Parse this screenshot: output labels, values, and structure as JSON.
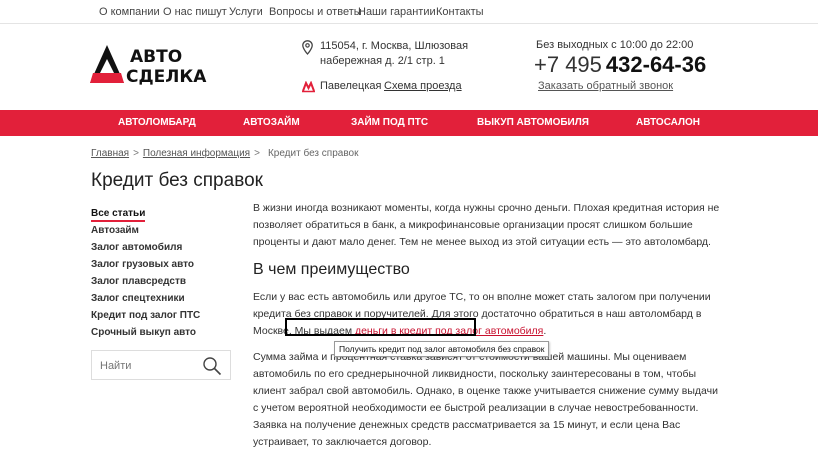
{
  "top_menu": {
    "about": "О компании",
    "press": "О нас пишут",
    "services": "Услуги",
    "faq": "Вопросы и ответы",
    "guarantees": "Наши гарантии",
    "contacts": "Контакты"
  },
  "logo": {
    "line1": "АВТО",
    "line2": "СДЕЛКА"
  },
  "header": {
    "address_line1": "115054, г. Москва, Шлюзовая",
    "address_line2": "набережная д. 2/1 стр. 1",
    "metro": "Павелецкая",
    "route_link": "Схема проезда",
    "hours": "Без выходных с 10:00 до 22:00",
    "phone_code": "+7 495",
    "phone_number": "432-64-36",
    "callback": "Заказать обратный звонок"
  },
  "nav": {
    "item1": "АВТОЛОМБАРД",
    "item2": "АВТОЗАЙМ",
    "item3": "ЗАЙМ ПОД ПТС",
    "item4": "ВЫКУП АВТОМОБИЛЯ",
    "item5": "АВТОСАЛОН"
  },
  "breadcrumb": {
    "home": "Главная",
    "section": "Полезная информация",
    "current": "Кредит без справок",
    "sep": ">"
  },
  "page_title": "Кредит без справок",
  "sidebar": {
    "items": [
      "Все статьи",
      "Автозайм",
      "Залог автомобиля",
      "Залог грузовых авто",
      "Залог плавсредств",
      "Залог спецтехники",
      "Кредит под залог ПТС",
      "Срочный выкуп авто"
    ]
  },
  "search": {
    "placeholder": "Найти"
  },
  "article": {
    "p1": "В жизни иногда возникают моменты, когда нужны срочно деньги. Плохая кредитная история не позволяет обратиться в банк, а микрофинансовые организации просят слишком большие проценты и дают мало денег. Тем не менее выход из этой ситуации есть — это автоломбард.",
    "h2": "В чем преимущество",
    "p2_before": "Если у вас есть автомобиль или другое ТС, то он вполне может стать залогом при получении кредита без справок и поручителей. Для этого достаточно обратиться в наш автоломбард в Москве. Мы выдаем ",
    "p2_link": "деньги в кредит под залог автомобиля",
    "p2_after": ".",
    "p3": "Сумма займа и процентная ставка зависят от стоимости вашей машины. Мы оцениваем автомобиль по его среднерыночной ликвидности, поскольку заинтересованы в том, чтобы клиент забрал свой автомобиль. Однако, в оценке также учитывается снижение сумму выдачи с учетом вероятной необходимости ее быстрой реализации в случае невостребованности. Заявка на получение денежных средств рассматривается за 15 минут, и если цена Вас устраивает, то заключается договор.",
    "tooltip": "Получить кредит под залог автомобиля без справок"
  },
  "colors": {
    "accent": "#e2203a",
    "link": "#c8102e"
  },
  "icons": {
    "address": "map-pin-icon",
    "metro": "metro-icon",
    "search": "search-icon"
  }
}
